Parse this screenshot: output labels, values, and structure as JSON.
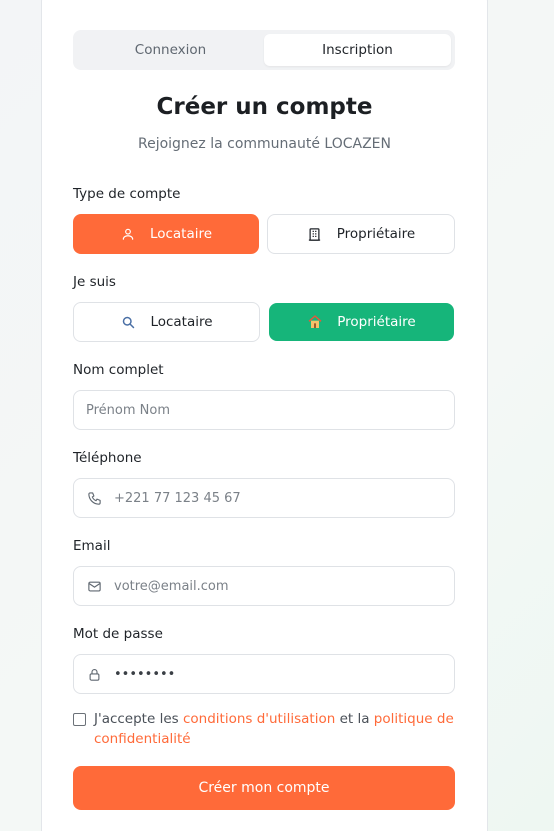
{
  "tabs": [
    {
      "label": "Connexion",
      "active": false
    },
    {
      "label": "Inscription",
      "active": true
    }
  ],
  "title": "Créer un compte",
  "subtitle": "Rejoignez la communauté LOCAZEN",
  "account_type": {
    "label": "Type de compte",
    "options": [
      {
        "label": "Locataire",
        "icon": "user-icon",
        "selected": true
      },
      {
        "label": "Propriétaire",
        "icon": "building-icon",
        "selected": false
      }
    ]
  },
  "je_suis": {
    "label": "Je suis",
    "options": [
      {
        "label": "Locataire",
        "icon": "search-icon",
        "selected": false
      },
      {
        "label": "Propriétaire",
        "icon": "house-icon",
        "selected": true
      }
    ]
  },
  "fields": {
    "name": {
      "label": "Nom complet",
      "placeholder": "Prénom Nom",
      "value": ""
    },
    "phone": {
      "label": "Téléphone",
      "placeholder": "+221 77 123 45 67",
      "value": ""
    },
    "email": {
      "label": "Email",
      "placeholder": "votre@email.com",
      "value": ""
    },
    "password": {
      "label": "Mot de passe",
      "value": "••••••••"
    }
  },
  "terms": {
    "checked": false,
    "prefix": "J'accepte les",
    "link1": "conditions d'utilisation",
    "middle": "et la",
    "link2": "politique de confidentialité"
  },
  "submit_label": "Créer mon compte",
  "colors": {
    "accent_orange": "#ff6a39",
    "accent_green": "#16b57a"
  }
}
